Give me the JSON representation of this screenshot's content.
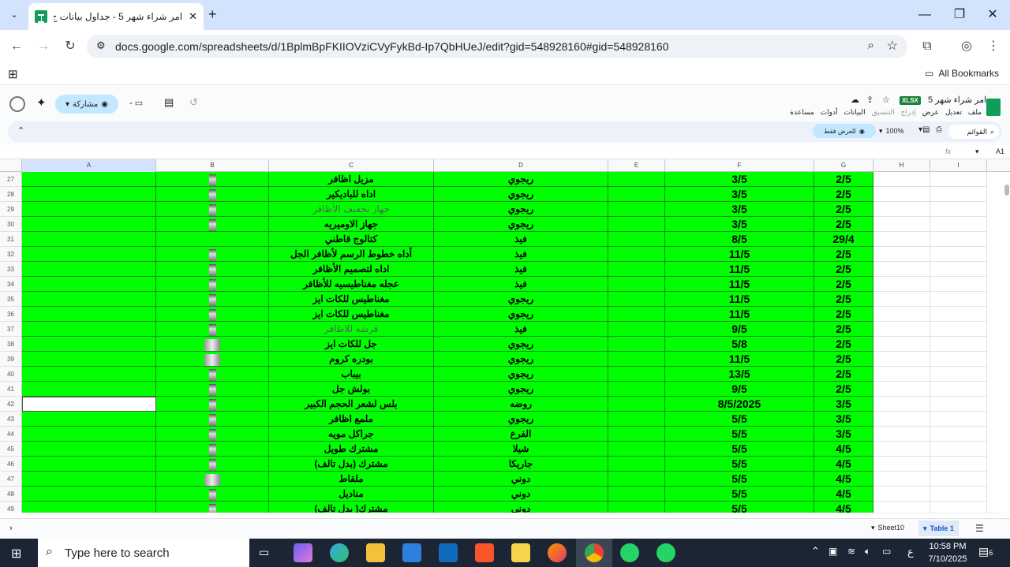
{
  "browser": {
    "tab_title": "امر شراء شهر 5 - جداول بيانات ج",
    "new_tab": "+",
    "url": "docs.google.com/spreadsheets/d/1BplmBpFKIIOVziCVyFykBd-Ip7QbHUeJ/edit?gid=548928160#gid=548928160",
    "bookmarks_label": "All Bookmarks"
  },
  "docs": {
    "title": "امر شراء شهر 5",
    "badge": "XLSX",
    "menus": [
      "ملف",
      "تعديل",
      "عرض",
      "إدراج",
      "التنسيق",
      "البيانات",
      "أدوات",
      "مساعدة"
    ],
    "share": "مشاركة",
    "search_menus": "القوائم",
    "zoom": "100%",
    "view_only": "للعرض فقط",
    "cell_ref": "A1",
    "fx": "fx"
  },
  "columns": [
    "A",
    "B",
    "C",
    "D",
    "E",
    "F",
    "G",
    "H",
    "I"
  ],
  "rows": [
    {
      "n": "27",
      "c": "مزيل اظافر",
      "d": "ريجوي",
      "f": "3/5",
      "g": "2/5"
    },
    {
      "n": "28",
      "c": "اداه للباديكير",
      "d": "ريجوي",
      "f": "3/5",
      "g": "2/5"
    },
    {
      "n": "29",
      "c": "جهاز تجفيف الأظافر",
      "d": "ريجوي",
      "f": "3/5",
      "g": "2/5",
      "faded": true
    },
    {
      "n": "30",
      "c": "جهاز الاوميريه",
      "d": "ريجوي",
      "f": "3/5",
      "g": "2/5"
    },
    {
      "n": "31",
      "c": "كتالوج قاطني",
      "d": "فيذ",
      "f": "8/5",
      "g": "29/4"
    },
    {
      "n": "32",
      "c": "أداه خطوط الرسم لأظافر الجل",
      "d": "فيذ",
      "f": "11/5",
      "g": "2/5"
    },
    {
      "n": "33",
      "c": "اداه لتصميم الأظافر",
      "d": "فيذ",
      "f": "11/5",
      "g": "2/5"
    },
    {
      "n": "34",
      "c": "عجله مغناطيسيه للأظافر",
      "d": "فيذ",
      "f": "11/5",
      "g": "2/5"
    },
    {
      "n": "35",
      "c": "مغناطيس للكات ايز",
      "d": "ريجوي",
      "f": "11/5",
      "g": "2/5"
    },
    {
      "n": "36",
      "c": "مغناطيس للكات ايز",
      "d": "ريجوي",
      "f": "11/5",
      "g": "2/5"
    },
    {
      "n": "37",
      "c": "فرشه للاظافر",
      "d": "فيذ",
      "f": "9/5",
      "g": "2/5",
      "faded": true
    },
    {
      "n": "38",
      "c": "جل للكات ايز",
      "d": "ريجوي",
      "f": "5/8",
      "g": "2/5"
    },
    {
      "n": "39",
      "c": "بودره كروم",
      "d": "ريجوي",
      "f": "11/5",
      "g": "2/5"
    },
    {
      "n": "40",
      "c": "بيباب",
      "d": "ريجوي",
      "f": "13/5",
      "g": "2/5"
    },
    {
      "n": "41",
      "c": "بولش جل",
      "d": "ريجوي",
      "f": "9/5",
      "g": "2/5"
    },
    {
      "n": "42",
      "c": "بلس لشعر الحجم الكبير",
      "d": "روضه",
      "f": "8/5/2025",
      "g": "3/5",
      "a_white": true
    },
    {
      "n": "43",
      "c": "ملمع اظافر",
      "d": "ريجوي",
      "f": "5/5",
      "g": "3/5"
    },
    {
      "n": "44",
      "c": "جراكل مويه",
      "d": "الفرع",
      "f": "5/5",
      "g": "3/5"
    },
    {
      "n": "45",
      "c": "مشترك طويل",
      "d": "شيلا",
      "f": "5/5",
      "g": "4/5"
    },
    {
      "n": "46",
      "c": "مشترك (بدل تالف)",
      "d": "جاريكا",
      "f": "5/5",
      "g": "4/5"
    },
    {
      "n": "47",
      "c": "ملقاط",
      "d": "دوني",
      "f": "5/5",
      "g": "4/5"
    },
    {
      "n": "48",
      "c": "مناديل",
      "d": "دوني",
      "f": "5/5",
      "g": "4/5"
    },
    {
      "n": "49",
      "c": "مشترك( بدل تالف)",
      "d": "دوني",
      "f": "5/5",
      "g": "4/5"
    }
  ],
  "sheets": {
    "s1": "Sheet10",
    "s2": "Table 1"
  },
  "taskbar": {
    "search_placeholder": "Type here to search",
    "time": "10:58 PM",
    "date": "7/10/2025",
    "lang": "ع",
    "notif": "6"
  },
  "colors": {
    "green": "#00ff00",
    "tabstrip": "#d3e3fd",
    "taskbar": "#1c2534"
  }
}
